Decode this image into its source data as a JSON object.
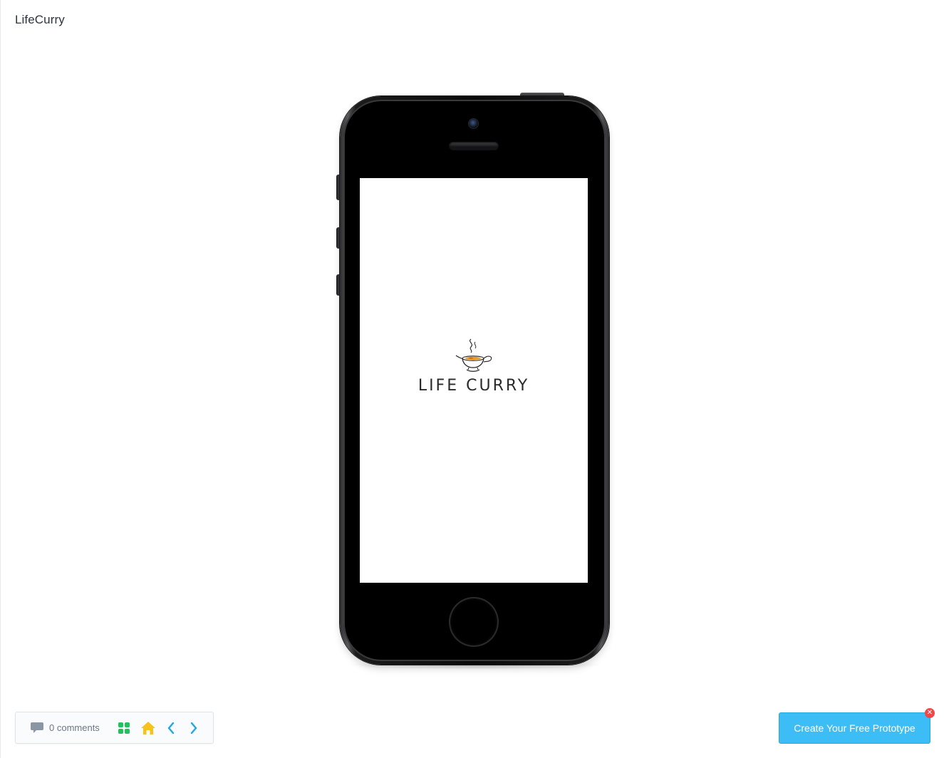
{
  "project": {
    "title": "LifeCurry"
  },
  "app_screen": {
    "wordmark": "LIFE CURRY",
    "logo_icon": "steaming-curry-bowl-icon"
  },
  "device": {
    "model_icon": "iphone-5s-frame"
  },
  "toolbar": {
    "comments_label": "0 comments",
    "comments_icon": "speech-bubble-icon",
    "grid_icon": "grid-icon",
    "home_icon": "home-icon",
    "prev_icon": "chevron-left-icon",
    "next_icon": "chevron-right-icon"
  },
  "cta": {
    "label": "Create Your Free Prototype",
    "close_icon": "close-icon"
  },
  "colors": {
    "grid_icon": "#22c15e",
    "home_icon": "#f7c21b",
    "nav_arrows": "#1fa8e4",
    "cta_background": "#3dbdf5",
    "cta_close": "#f0484a",
    "comment_icon": "#8a96a3"
  }
}
